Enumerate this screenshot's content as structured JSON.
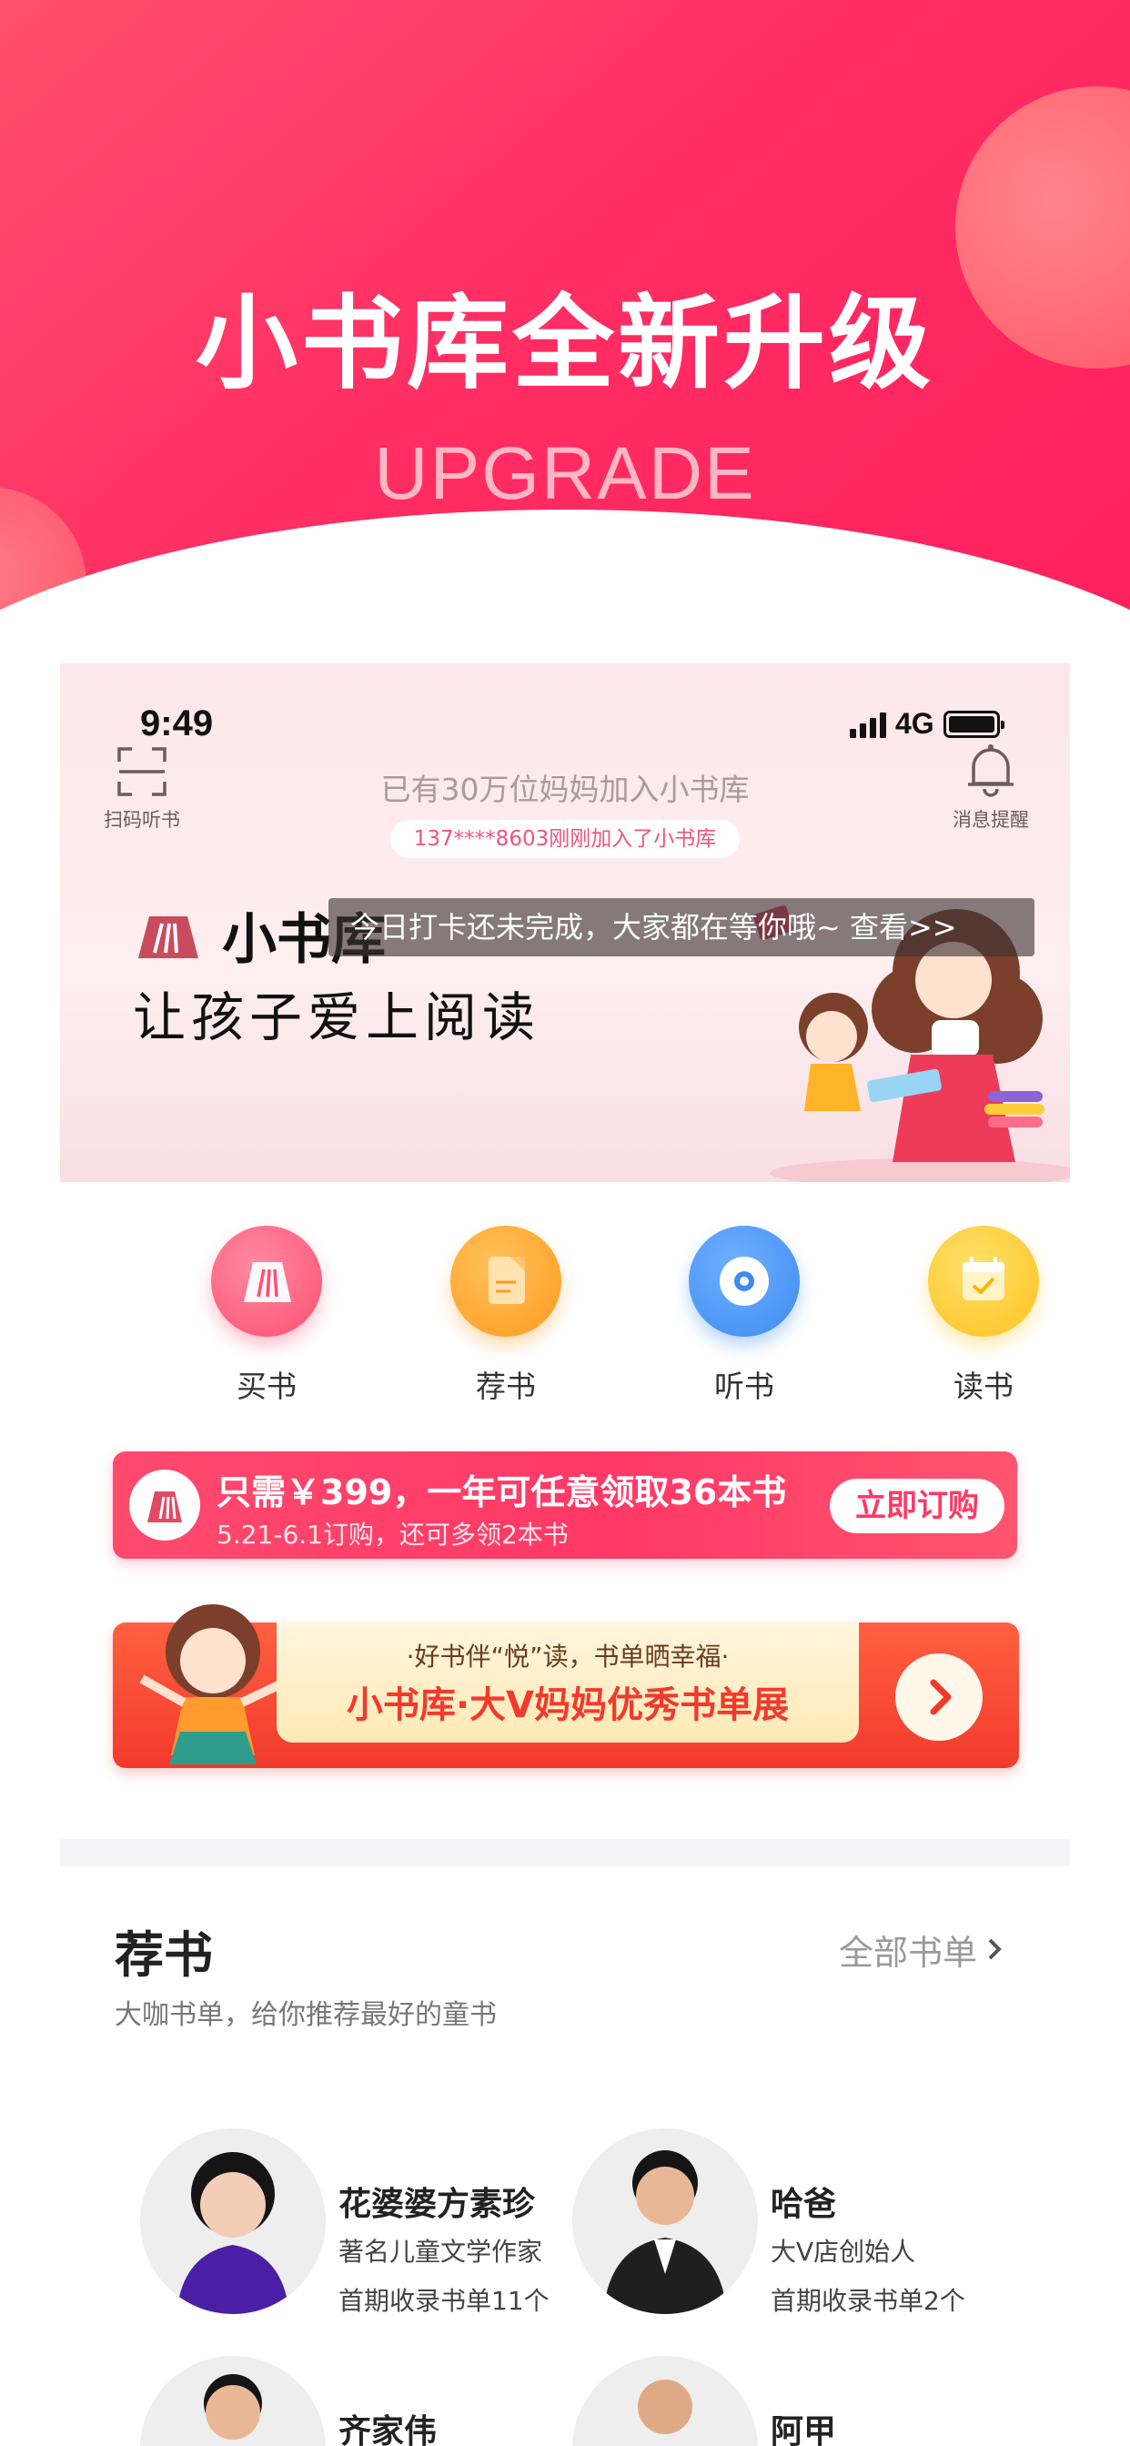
{
  "hero": {
    "title": "小书库全新升级",
    "subtitle": "UPGRADE"
  },
  "status_bar": {
    "time": "9:49",
    "network": "4G"
  },
  "header": {
    "scan_label": "扫码听书",
    "join_text": "已有30万位妈妈加入小书库",
    "join_notice": "137****8603刚刚加入了小书库",
    "bell_label": "消息提醒"
  },
  "banner": {
    "brand": "小书库",
    "slogan": "让孩子爱上阅读",
    "toast": "今日打卡还未完成，大家都在等你哦~ 查看>>"
  },
  "categories": [
    {
      "label": "买书",
      "icon": "book-stack-icon",
      "color": "#ff4f72"
    },
    {
      "label": "荐书",
      "icon": "document-icon",
      "color": "#ff9a1f"
    },
    {
      "label": "听书",
      "icon": "disc-icon",
      "color": "#3d8bf2"
    },
    {
      "label": "读书",
      "icon": "calendar-check-icon",
      "color": "#ffc220"
    }
  ],
  "promo": {
    "main": "只需￥399，一年可任意领取36本书",
    "sub": "5.21-6.1订购，还可多领2本书",
    "button": "立即订购"
  },
  "showcase": {
    "top": "·好书伴“悦”读，书单晒幸福·",
    "main": "小书库·大V妈妈优秀书单展"
  },
  "recommend": {
    "title": "荐书",
    "all_link": "全部书单",
    "subtitle": "大咖书单，给你推荐最好的童书",
    "people": [
      {
        "name": "花婆婆方素珍",
        "desc": "著名儿童文学作家",
        "count": "首期收录书单11个"
      },
      {
        "name": "哈爸",
        "desc": "大V店创始人",
        "count": "首期收录书单2个"
      },
      {
        "name": "齐家伟",
        "desc": "",
        "count": ""
      },
      {
        "name": "阿甲",
        "desc": "",
        "count": ""
      }
    ]
  }
}
